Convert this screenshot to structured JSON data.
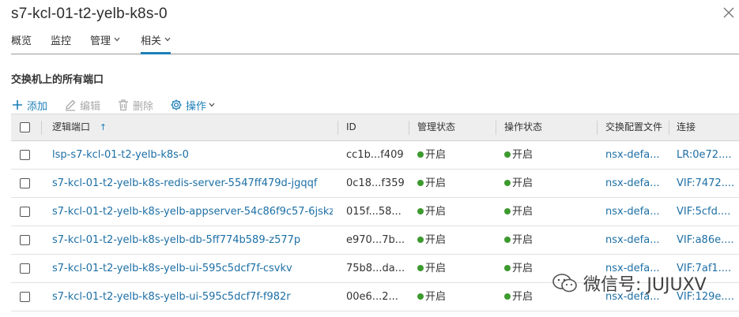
{
  "title": "s7-kcl-01-t2-yelb-k8s-0",
  "tabs": [
    {
      "label": "概览"
    },
    {
      "label": "监控"
    },
    {
      "label": "管理"
    },
    {
      "label": "相关"
    }
  ],
  "section_title": "交换机上的所有端口",
  "toolbar": {
    "add": "添加",
    "edit": "编辑",
    "delete": "删除",
    "actions": "操作"
  },
  "table": {
    "columns": [
      "逻辑端口",
      "ID",
      "管理状态",
      "操作状态",
      "交换配置文件",
      "连接"
    ],
    "sort_indicator": "↑",
    "rows": [
      {
        "name": "lsp-s7-kcl-01-t2-yelb-k8s-0",
        "id": "cc1b...f409",
        "admin": "开启",
        "oper": "开启",
        "profile": "nsx-defa...",
        "conn": "LR:0e72...."
      },
      {
        "name": "s7-kcl-01-t2-yelb-k8s-redis-server-5547ff479d-jgqqf",
        "id": "0c18...f359",
        "admin": "开启",
        "oper": "开启",
        "profile": "nsx-defa...",
        "conn": "VIF:7472...."
      },
      {
        "name": "s7-kcl-01-t2-yelb-k8s-yelb-appserver-54c86f9c57-6jskz",
        "id": "015f...58...",
        "admin": "开启",
        "oper": "开启",
        "profile": "nsx-defa...",
        "conn": "VIF:5cfd...."
      },
      {
        "name": "s7-kcl-01-t2-yelb-k8s-yelb-db-5ff774b589-z577p",
        "id": "e970...7b...",
        "admin": "开启",
        "oper": "开启",
        "profile": "nsx-defa...",
        "conn": "VIF:a86e...."
      },
      {
        "name": "s7-kcl-01-t2-yelb-k8s-yelb-ui-595c5dcf7f-csvkv",
        "id": "75b8...da...",
        "admin": "开启",
        "oper": "开启",
        "profile": "nsx-defa...",
        "conn": "VIF:7af1...."
      },
      {
        "name": "s7-kcl-01-t2-yelb-k8s-yelb-ui-595c5dcf7f-f982r",
        "id": "00e6...2...",
        "admin": "开启",
        "oper": "开启",
        "profile": "nsx-defa...",
        "conn": "VIF:129e...."
      }
    ]
  },
  "watermark": "微信号: JUJUXV",
  "colors": {
    "accent": "#1d7fb7",
    "link": "#1d6fa5",
    "status_green": "#3c9a2e",
    "header_bg": "#eeeeee"
  }
}
